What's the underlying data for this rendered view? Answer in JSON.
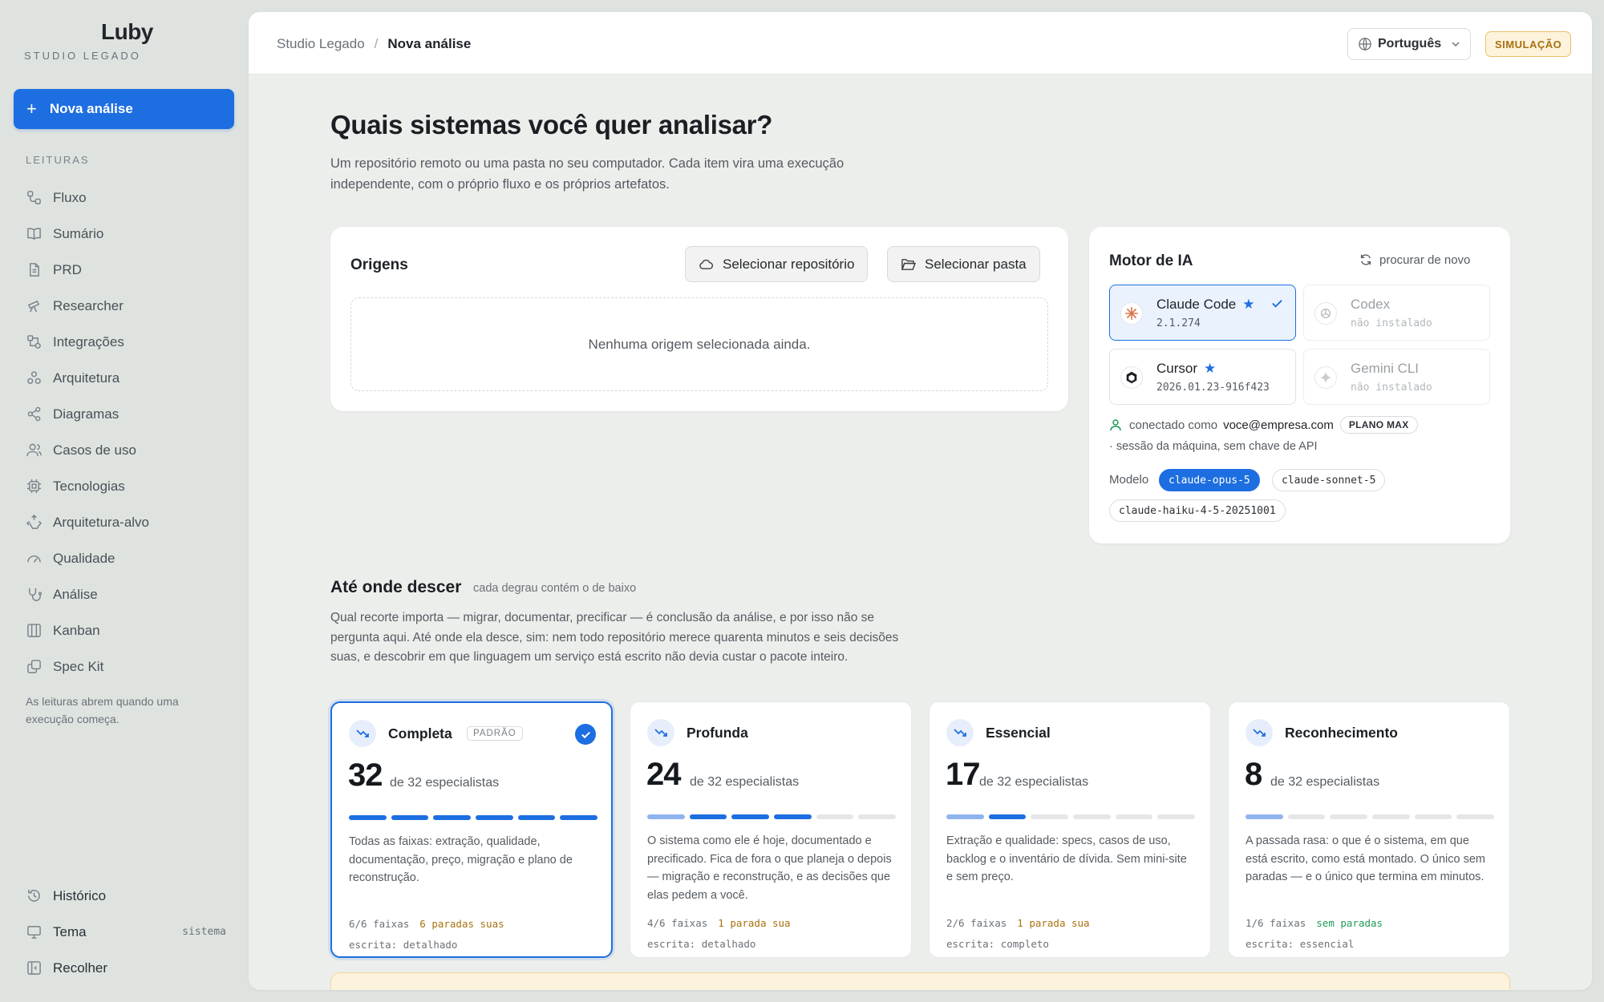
{
  "brand": {
    "logo": "Luby",
    "subtitle": "STUDIO LEGADO"
  },
  "sidebar": {
    "new_button": "Nova análise",
    "section_label": "LEITURAS",
    "items": [
      {
        "label": "Fluxo",
        "icon": "flow-icon"
      },
      {
        "label": "Sumário",
        "icon": "book-icon"
      },
      {
        "label": "PRD",
        "icon": "document-icon"
      },
      {
        "label": "Researcher",
        "icon": "telescope-icon"
      },
      {
        "label": "Integrações",
        "icon": "integrations-icon"
      },
      {
        "label": "Arquitetura",
        "icon": "architecture-icon"
      },
      {
        "label": "Diagramas",
        "icon": "share-nodes-icon"
      },
      {
        "label": "Casos de uso",
        "icon": "users-icon"
      },
      {
        "label": "Tecnologias",
        "icon": "chip-icon"
      },
      {
        "label": "Arquitetura-alvo",
        "icon": "recycle-icon"
      },
      {
        "label": "Qualidade",
        "icon": "gauge-icon"
      },
      {
        "label": "Análise",
        "icon": "stethoscope-icon"
      },
      {
        "label": "Kanban",
        "icon": "kanban-icon"
      },
      {
        "label": "Spec Kit",
        "icon": "copy-icon"
      }
    ],
    "note": "As leituras abrem quando uma execução começa.",
    "bottom": {
      "history": "Histórico",
      "theme": "Tema",
      "theme_value": "sistema",
      "collapse": "Recolher"
    }
  },
  "header": {
    "breadcrumb_parent": "Studio Legado",
    "breadcrumb_sep": "/",
    "breadcrumb_current": "Nova análise",
    "language": "Português",
    "badge": "SIMULAÇÃO"
  },
  "page": {
    "title": "Quais sistemas você quer analisar?",
    "subtitle": "Um repositório remoto ou uma pasta no seu computador. Cada item vira uma execução independente, com o próprio fluxo e os próprios artefatos."
  },
  "origins": {
    "title": "Origens",
    "select_repo": "Selecionar repositório",
    "select_folder": "Selecionar pasta",
    "empty": "Nenhuma origem selecionada ainda."
  },
  "engine": {
    "title": "Motor de IA",
    "rescan": "procurar de novo",
    "options": [
      {
        "name": "Claude Code",
        "version": "2.1.274",
        "starred": true,
        "selected": true,
        "installed": true
      },
      {
        "name": "Codex",
        "version": "não instalado",
        "starred": false,
        "selected": false,
        "installed": false
      },
      {
        "name": "Cursor",
        "version": "2026.01.23-916f423",
        "starred": true,
        "selected": false,
        "installed": true
      },
      {
        "name": "Gemini CLI",
        "version": "não instalado",
        "starred": false,
        "selected": false,
        "installed": false
      }
    ],
    "connected_prefix": "conectado como",
    "email": "voce@empresa.com",
    "plan": "PLANO MAX",
    "session": "· sessão da máquina, sem chave de API",
    "model_label": "Modelo",
    "models": [
      "claude-opus-5",
      "claude-sonnet-5",
      "claude-haiku-4-5-20251001"
    ],
    "selected_model": "claude-opus-5"
  },
  "depth": {
    "title": "Até onde descer",
    "hint": "cada degrau contém o de baixo",
    "description": "Qual recorte importa — migrar, documentar, precificar — é conclusão da análise, e por isso não se pergunta aqui. Até onde ela desce, sim: nem todo repositório merece quarenta minutos e seis decisões suas, e descobrir em que linguagem um serviço está escrito não devia custar o pacote inteiro.",
    "levels": [
      {
        "name": "Completa",
        "tag": "PADRÃO",
        "selected": true,
        "count": "32",
        "of": "de 32 especialistas",
        "bars": [
          "on",
          "on",
          "on",
          "on",
          "on",
          "on"
        ],
        "desc": "Todas as faixas: extração, qualidade, documentação, preço, migração e plano de reconstrução.",
        "lanes": "6/6 faixas",
        "stops": "6 paradas suas",
        "stops_none": false,
        "writing": "escrita: detalhado"
      },
      {
        "name": "Profunda",
        "tag": "",
        "selected": false,
        "count": "24",
        "of": "de 32 especialistas",
        "bars": [
          "light",
          "on",
          "on",
          "on",
          "off",
          "off"
        ],
        "desc": "O sistema como ele é hoje, documentado e precificado. Fica de fora o que planeja o depois — migração e reconstrução, e as decisões que elas pedem a você.",
        "lanes": "4/6 faixas",
        "stops": "1 parada sua",
        "stops_none": false,
        "writing": "escrita: detalhado"
      },
      {
        "name": "Essencial",
        "tag": "",
        "selected": false,
        "count": "17",
        "of": "de 32 especialistas",
        "bars": [
          "light",
          "on",
          "off",
          "off",
          "off",
          "off"
        ],
        "desc": "Extração e qualidade: specs, casos de uso, backlog e o inventário de dívida. Sem mini-site e sem preço.",
        "lanes": "2/6 faixas",
        "stops": "1 parada sua",
        "stops_none": false,
        "writing": "escrita: completo"
      },
      {
        "name": "Reconhecimento",
        "tag": "",
        "selected": false,
        "count": "8",
        "of": "de 32 especialistas",
        "bars": [
          "light",
          "off",
          "off",
          "off",
          "off",
          "off"
        ],
        "desc": "A passada rasa: o que é o sistema, em que está escrito, como está montado. O único sem paradas — e o único que termina em minutos.",
        "lanes": "1/6 faixas",
        "stops": "sem paradas",
        "stops_none": true,
        "writing": "escrita: essencial"
      }
    ]
  },
  "colors": {
    "accent": "#1d6ee0",
    "warning": "#a9700f",
    "success": "#1f9a5a"
  }
}
